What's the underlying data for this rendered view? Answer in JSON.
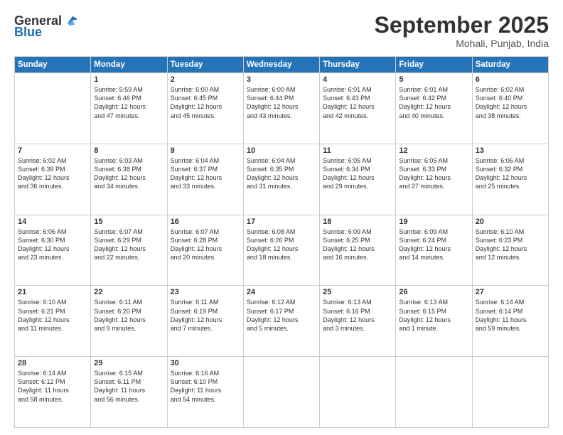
{
  "header": {
    "logo_general": "General",
    "logo_blue": "Blue",
    "month_title": "September 2025",
    "location": "Mohali, Punjab, India"
  },
  "days_of_week": [
    "Sunday",
    "Monday",
    "Tuesday",
    "Wednesday",
    "Thursday",
    "Friday",
    "Saturday"
  ],
  "weeks": [
    [
      {
        "day": "",
        "content": ""
      },
      {
        "day": "1",
        "content": "Sunrise: 5:59 AM\nSunset: 6:46 PM\nDaylight: 12 hours\nand 47 minutes."
      },
      {
        "day": "2",
        "content": "Sunrise: 6:00 AM\nSunset: 6:45 PM\nDaylight: 12 hours\nand 45 minutes."
      },
      {
        "day": "3",
        "content": "Sunrise: 6:00 AM\nSunset: 6:44 PM\nDaylight: 12 hours\nand 43 minutes."
      },
      {
        "day": "4",
        "content": "Sunrise: 6:01 AM\nSunset: 6:43 PM\nDaylight: 12 hours\nand 42 minutes."
      },
      {
        "day": "5",
        "content": "Sunrise: 6:01 AM\nSunset: 6:42 PM\nDaylight: 12 hours\nand 40 minutes."
      },
      {
        "day": "6",
        "content": "Sunrise: 6:02 AM\nSunset: 6:40 PM\nDaylight: 12 hours\nand 38 minutes."
      }
    ],
    [
      {
        "day": "7",
        "content": "Sunrise: 6:02 AM\nSunset: 6:39 PM\nDaylight: 12 hours\nand 36 minutes."
      },
      {
        "day": "8",
        "content": "Sunrise: 6:03 AM\nSunset: 6:38 PM\nDaylight: 12 hours\nand 34 minutes."
      },
      {
        "day": "9",
        "content": "Sunrise: 6:04 AM\nSunset: 6:37 PM\nDaylight: 12 hours\nand 33 minutes."
      },
      {
        "day": "10",
        "content": "Sunrise: 6:04 AM\nSunset: 6:35 PM\nDaylight: 12 hours\nand 31 minutes."
      },
      {
        "day": "11",
        "content": "Sunrise: 6:05 AM\nSunset: 6:34 PM\nDaylight: 12 hours\nand 29 minutes."
      },
      {
        "day": "12",
        "content": "Sunrise: 6:05 AM\nSunset: 6:33 PM\nDaylight: 12 hours\nand 27 minutes."
      },
      {
        "day": "13",
        "content": "Sunrise: 6:06 AM\nSunset: 6:32 PM\nDaylight: 12 hours\nand 25 minutes."
      }
    ],
    [
      {
        "day": "14",
        "content": "Sunrise: 6:06 AM\nSunset: 6:30 PM\nDaylight: 12 hours\nand 23 minutes."
      },
      {
        "day": "15",
        "content": "Sunrise: 6:07 AM\nSunset: 6:29 PM\nDaylight: 12 hours\nand 22 minutes."
      },
      {
        "day": "16",
        "content": "Sunrise: 6:07 AM\nSunset: 6:28 PM\nDaylight: 12 hours\nand 20 minutes."
      },
      {
        "day": "17",
        "content": "Sunrise: 6:08 AM\nSunset: 6:26 PM\nDaylight: 12 hours\nand 18 minutes."
      },
      {
        "day": "18",
        "content": "Sunrise: 6:09 AM\nSunset: 6:25 PM\nDaylight: 12 hours\nand 16 minutes."
      },
      {
        "day": "19",
        "content": "Sunrise: 6:09 AM\nSunset: 6:24 PM\nDaylight: 12 hours\nand 14 minutes."
      },
      {
        "day": "20",
        "content": "Sunrise: 6:10 AM\nSunset: 6:23 PM\nDaylight: 12 hours\nand 12 minutes."
      }
    ],
    [
      {
        "day": "21",
        "content": "Sunrise: 6:10 AM\nSunset: 6:21 PM\nDaylight: 12 hours\nand 11 minutes."
      },
      {
        "day": "22",
        "content": "Sunrise: 6:11 AM\nSunset: 6:20 PM\nDaylight: 12 hours\nand 9 minutes."
      },
      {
        "day": "23",
        "content": "Sunrise: 6:11 AM\nSunset: 6:19 PM\nDaylight: 12 hours\nand 7 minutes."
      },
      {
        "day": "24",
        "content": "Sunrise: 6:12 AM\nSunset: 6:17 PM\nDaylight: 12 hours\nand 5 minutes."
      },
      {
        "day": "25",
        "content": "Sunrise: 6:13 AM\nSunset: 6:16 PM\nDaylight: 12 hours\nand 3 minutes."
      },
      {
        "day": "26",
        "content": "Sunrise: 6:13 AM\nSunset: 6:15 PM\nDaylight: 12 hours\nand 1 minute."
      },
      {
        "day": "27",
        "content": "Sunrise: 6:14 AM\nSunset: 6:14 PM\nDaylight: 11 hours\nand 59 minutes."
      }
    ],
    [
      {
        "day": "28",
        "content": "Sunrise: 6:14 AM\nSunset: 6:12 PM\nDaylight: 11 hours\nand 58 minutes."
      },
      {
        "day": "29",
        "content": "Sunrise: 6:15 AM\nSunset: 6:11 PM\nDaylight: 11 hours\nand 56 minutes."
      },
      {
        "day": "30",
        "content": "Sunrise: 6:16 AM\nSunset: 6:10 PM\nDaylight: 11 hours\nand 54 minutes."
      },
      {
        "day": "",
        "content": ""
      },
      {
        "day": "",
        "content": ""
      },
      {
        "day": "",
        "content": ""
      },
      {
        "day": "",
        "content": ""
      }
    ]
  ]
}
